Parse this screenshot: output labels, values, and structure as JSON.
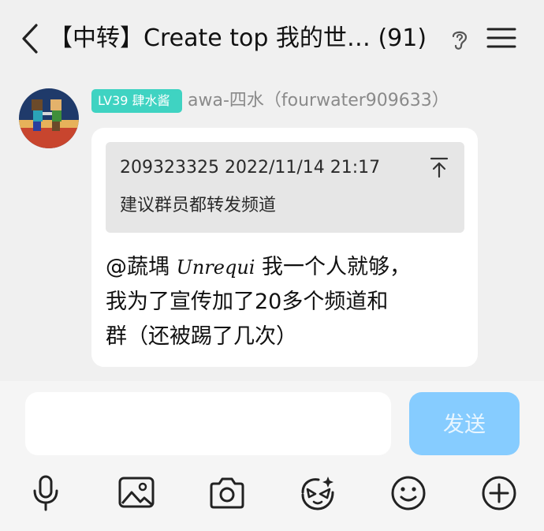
{
  "header": {
    "title": "【中转】Create top 我的世…  (91)",
    "back_icon": "chevron-left-icon",
    "ear_icon": "ear-icon",
    "menu_icon": "hamburger-menu-icon"
  },
  "message": {
    "badge": "LV39 肆水酱",
    "sender": "awa-四水（fourwater909633）",
    "quote": {
      "meta": "209323325 2022/11/14 21:17",
      "text": "建议群员都转发频道"
    },
    "mention": "@蔬堣",
    "mention_name": "Unrequi",
    "text_line1": "我一个人就够，",
    "text_line2": "我为了宣传加了20多个频道和",
    "text_line3": "群（还被踢了几次）"
  },
  "composer": {
    "input_value": "",
    "send_label": "发送",
    "tools": [
      "microphone-icon",
      "image-icon",
      "camera-icon",
      "sticker-face-icon",
      "emoji-icon",
      "plus-circle-icon"
    ]
  },
  "colors": {
    "badge": "#3fd3c2",
    "send_button": "#86ccff",
    "background": "#f0f0f0"
  }
}
